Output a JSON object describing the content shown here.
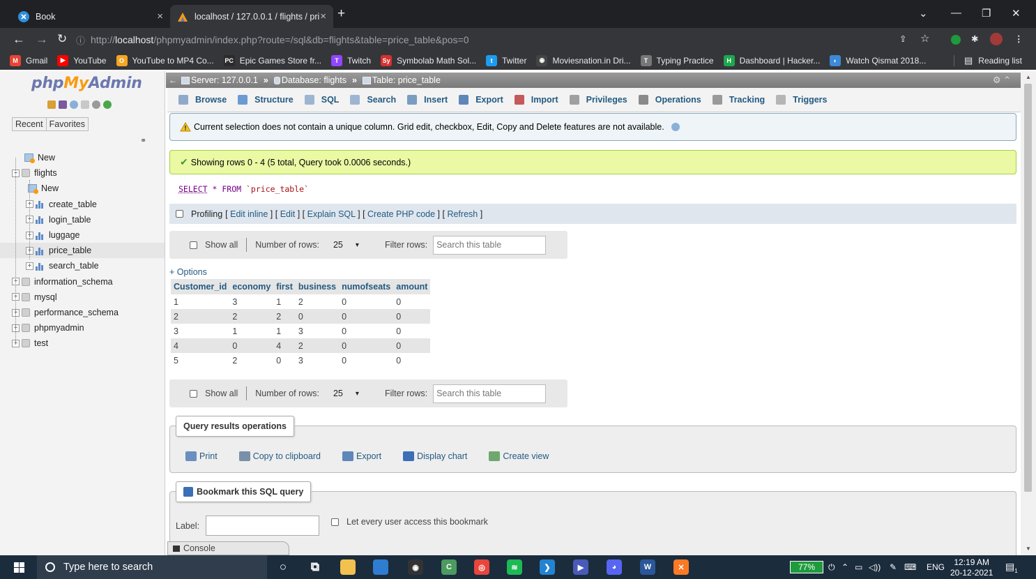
{
  "browser": {
    "tabs": [
      {
        "title": "Book",
        "close": "×"
      },
      {
        "title": "localhost / 127.0.0.1 / flights / pri",
        "close": "×"
      }
    ],
    "new_tab": "+",
    "url_host": "localhost",
    "url_prefix": "http://",
    "url_path": "/phpmyadmin/index.php?route=/sql&db=flights&table=price_table&pos=0",
    "bookmarks": [
      {
        "label": "Gmail",
        "icon": "gmail-icon",
        "color": "#ea4335",
        "glyph": "M"
      },
      {
        "label": "YouTube",
        "icon": "youtube-icon",
        "color": "#ff0000",
        "glyph": "▶"
      },
      {
        "label": "YouTube to MP4 Co...",
        "icon": "youtube-mp4-icon",
        "color": "#f5a623",
        "glyph": "O"
      },
      {
        "label": "Epic Games Store fr...",
        "icon": "epic-games-icon",
        "color": "#2b2b2b",
        "glyph": "PC"
      },
      {
        "label": "Twitch",
        "icon": "twitch-icon",
        "color": "#9146ff",
        "glyph": "T"
      },
      {
        "label": "Symbolab Math Sol...",
        "icon": "symbolab-icon",
        "color": "#d9302f",
        "glyph": "Sy"
      },
      {
        "label": "Twitter",
        "icon": "twitter-icon",
        "color": "#1d9bf0",
        "glyph": "t"
      },
      {
        "label": "Moviesnation.in Dri...",
        "icon": "moviesnation-icon",
        "color": "#444",
        "glyph": "◉"
      },
      {
        "label": "Typing Practice",
        "icon": "typing-practice-icon",
        "color": "#777",
        "glyph": "T"
      },
      {
        "label": "Dashboard | Hacker...",
        "icon": "hackerrank-icon",
        "color": "#1ba94c",
        "glyph": "H"
      },
      {
        "label": "Watch Qismat 2018...",
        "icon": "watch-icon",
        "color": "#3c8ad8",
        "glyph": "◐"
      }
    ],
    "reading_list": "Reading list"
  },
  "pma": {
    "logo_php": "php",
    "logo_my": "My",
    "logo_admin": "Admin",
    "nav_tabs": [
      "Recent",
      "Favorites"
    ],
    "tree": [
      {
        "label": "New",
        "kind": "new",
        "level": 1
      },
      {
        "label": "flights",
        "kind": "db",
        "level": 0,
        "expanded": true
      },
      {
        "label": "New",
        "kind": "new",
        "level": 2
      },
      {
        "label": "create_table",
        "kind": "table",
        "level": 2
      },
      {
        "label": "login_table",
        "kind": "table",
        "level": 2
      },
      {
        "label": "luggage",
        "kind": "table",
        "level": 2
      },
      {
        "label": "price_table",
        "kind": "table",
        "level": 2,
        "selected": true
      },
      {
        "label": "search_table",
        "kind": "table",
        "level": 2
      },
      {
        "label": "information_schema",
        "kind": "db",
        "level": 0
      },
      {
        "label": "mysql",
        "kind": "db",
        "level": 0
      },
      {
        "label": "performance_schema",
        "kind": "db",
        "level": 0
      },
      {
        "label": "phpmyadmin",
        "kind": "db",
        "level": 0
      },
      {
        "label": "test",
        "kind": "db",
        "level": 0
      }
    ],
    "breadcrumb": [
      {
        "label": "Server: 127.0.0.1"
      },
      {
        "label": "Database: flights"
      },
      {
        "label": "Table: price_table"
      }
    ],
    "breadcrumb_sep": "»",
    "tabs": [
      {
        "label": "Browse",
        "icon": "browse-icon",
        "color": "#8fa9c9"
      },
      {
        "label": "Structure",
        "icon": "structure-icon",
        "color": "#6b9bd1"
      },
      {
        "label": "SQL",
        "icon": "sql-icon",
        "color": "#9cb5d1"
      },
      {
        "label": "Search",
        "icon": "search-icon",
        "color": "#9cb5d1"
      },
      {
        "label": "Insert",
        "icon": "insert-icon",
        "color": "#7a9cc0"
      },
      {
        "label": "Export",
        "icon": "export-icon",
        "color": "#5f86b8"
      },
      {
        "label": "Import",
        "icon": "import-icon",
        "color": "#c45a5a"
      },
      {
        "label": "Privileges",
        "icon": "privileges-icon",
        "color": "#a0a0a0"
      },
      {
        "label": "Operations",
        "icon": "operations-icon",
        "color": "#8a8a8a"
      },
      {
        "label": "Tracking",
        "icon": "tracking-icon",
        "color": "#9a9a9a"
      },
      {
        "label": "Triggers",
        "icon": "triggers-icon",
        "color": "#b5b5b5"
      }
    ],
    "warning": "Current selection does not contain a unique column. Grid edit, checkbox, Edit, Copy and Delete features are not available.",
    "success": "Showing rows 0 - 4 (5 total, Query took 0.0006 seconds.)",
    "sql": {
      "select": "SELECT",
      "star": "*",
      "from": "FROM",
      "table": "`price_table`"
    },
    "profiling": {
      "label": "Profiling",
      "links": [
        "Edit inline",
        "Edit",
        "Explain SQL",
        "Create PHP code",
        "Refresh"
      ]
    },
    "row_controls": {
      "show_all": "Show all",
      "number_of_rows": "Number of rows:",
      "rows_value": "25",
      "filter_rows": "Filter rows:",
      "filter_placeholder": "Search this table"
    },
    "options": "+ Options",
    "results": {
      "columns": [
        "Customer_id",
        "economy",
        "first",
        "business",
        "numofseats",
        "amount"
      ],
      "rows": [
        [
          "1",
          "3",
          "1",
          "2",
          "0",
          "0"
        ],
        [
          "2",
          "2",
          "2",
          "0",
          "0",
          "0"
        ],
        [
          "3",
          "1",
          "1",
          "3",
          "0",
          "0"
        ],
        [
          "4",
          "0",
          "4",
          "2",
          "0",
          "0"
        ],
        [
          "5",
          "2",
          "0",
          "3",
          "0",
          "0"
        ]
      ]
    },
    "query_ops": {
      "title": "Query results operations",
      "items": [
        {
          "label": "Print",
          "icon": "print-icon",
          "color": "#6b8fbf"
        },
        {
          "label": "Copy to clipboard",
          "icon": "clipboard-icon",
          "color": "#7a8fa8"
        },
        {
          "label": "Export",
          "icon": "export-icon",
          "color": "#5f86b8"
        },
        {
          "label": "Display chart",
          "icon": "chart-icon",
          "color": "#3b6fb6"
        },
        {
          "label": "Create view",
          "icon": "create-view-icon",
          "color": "#6fa86f"
        }
      ]
    },
    "bookmark": {
      "title": "Bookmark this SQL query",
      "label": "Label:",
      "checkbox": "Let every user access this bookmark"
    },
    "console": "Console"
  },
  "taskbar": {
    "search_placeholder": "Type here to search",
    "apps": [
      {
        "name": "cortana-icon",
        "color": "transparent",
        "glyph": "○"
      },
      {
        "name": "task-view-icon",
        "color": "transparent",
        "glyph": "⧉"
      },
      {
        "name": "file-explorer-icon",
        "color": "#f2c14e",
        "glyph": ""
      },
      {
        "name": "store-icon",
        "color": "#2f7dd1",
        "glyph": ""
      },
      {
        "name": "obs-icon",
        "color": "#333",
        "glyph": "◉"
      },
      {
        "name": "camo-icon",
        "color": "#4c9a5f",
        "glyph": "C"
      },
      {
        "name": "chrome-icon",
        "color": "#e8453c",
        "glyph": "◎"
      },
      {
        "name": "spotify-icon",
        "color": "#1db954",
        "glyph": "≋"
      },
      {
        "name": "vscode-icon",
        "color": "#2383d1",
        "glyph": "❯"
      },
      {
        "name": "media-player-icon",
        "color": "#4a5ab8",
        "glyph": "▶"
      },
      {
        "name": "discord-icon",
        "color": "#5865f2",
        "glyph": "◕"
      },
      {
        "name": "word-icon",
        "color": "#2b579a",
        "glyph": "W"
      },
      {
        "name": "xampp-icon",
        "color": "#fb7a24",
        "glyph": "✕"
      }
    ],
    "battery": "77%",
    "lang": "ENG",
    "time": "12:19 AM",
    "date": "20-12-2021",
    "notification_count": "1"
  }
}
